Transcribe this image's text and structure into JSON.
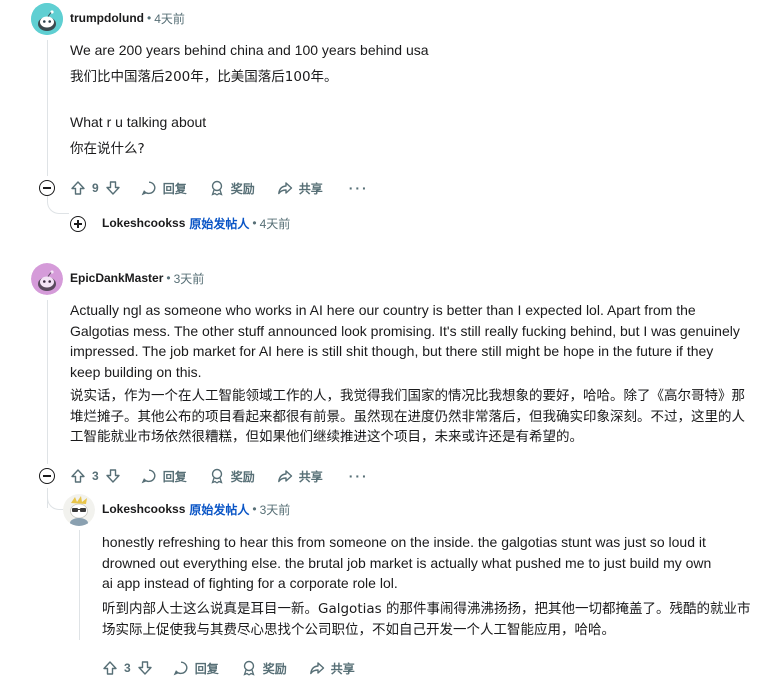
{
  "comments": [
    {
      "username": "trumpdolund",
      "time": "4天前",
      "paragraphs": [
        "We are 200 years behind china and 100 years behind usa",
        "我们比中国落后200年，比美国落后100年。",
        "What r u talking about",
        "你在说什么?"
      ],
      "votes": "9",
      "actions": {
        "reply": "回复",
        "award": "奖励",
        "share": "共享",
        "more": "···"
      },
      "collapsed_reply": {
        "username": "Lokeshcookss",
        "badge": "原始发帖人",
        "time": "4天前"
      }
    },
    {
      "username": "EpicDankMaster",
      "time": "3天前",
      "paragraphs": [
        "Actually ngl as someone who works in AI here our country is better than I expected lol. Apart from the Galgotias mess. The other stuff announced look promising. It's still really fucking behind, but I was genuinely impressed. The job market for AI here is still shit though, but there still might be hope in the future if they keep building on this.",
        "说实话，作为一个在人工智能领域工作的人，我觉得我们国家的情况比我想象的要好，哈哈。除了《高尔哥特》那堆烂摊子。其他公布的项目看起来都很有前景。虽然现在进度仍然非常落后，但我确实印象深刻。不过，这里的人工智能就业市场依然很糟糕，但如果他们继续推进这个项目，未来或许还是有希望的。"
      ],
      "votes": "3",
      "actions": {
        "reply": "回复",
        "award": "奖励",
        "share": "共享",
        "more": "···"
      }
    },
    {
      "username": "Lokeshcookss",
      "badge": "原始发帖人",
      "time": "3天前",
      "paragraphs": [
        "honestly refreshing to hear this from someone on the inside. the galgotias stunt was just so loud it drowned out everything else. the brutal job market is actually what pushed me to just build my own ai app instead of fighting for a corporate role lol.",
        "听到内部人士这么说真是耳目一新。Galgotias 的那件事闹得沸沸扬扬，把其他一切都掩盖了。残酷的就业市场实际上促使我与其费尽心思找个公司职位，不如自己开发一个人工智能应用，哈哈。"
      ],
      "votes": "3",
      "actions": {
        "reply": "回复",
        "award": "奖励",
        "share": "共享"
      }
    }
  ],
  "colors": {
    "accent_blue": "#0a55c6",
    "meta_gray": "#576f76",
    "thread_line": "#dfe3e6"
  }
}
